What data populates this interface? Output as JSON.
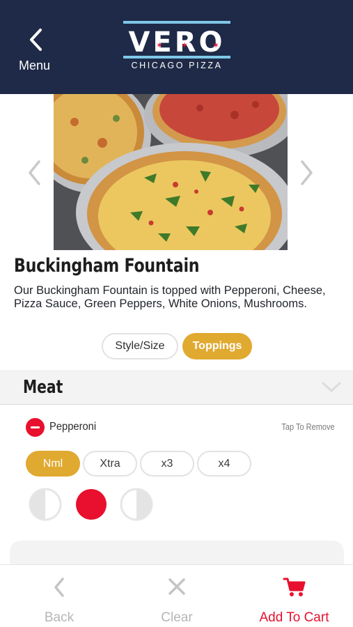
{
  "header": {
    "back_label": "Menu",
    "brand_name": "VERO",
    "brand_subtitle": "CHICAGO PIZZA"
  },
  "product": {
    "title": "Buckingham Fountain",
    "description": "Our Buckingham Fountain is topped with Pepperoni, Cheese, Pizza Sauce, Green Peppers, White Onions, Mushrooms."
  },
  "tabs": [
    {
      "label": "Style/Size",
      "active": false
    },
    {
      "label": "Toppings",
      "active": true
    }
  ],
  "section": {
    "title": "Meat"
  },
  "topping": {
    "name": "Pepperoni",
    "hint": "Tap To Remove",
    "amounts": [
      {
        "label": "Nml",
        "selected": true
      },
      {
        "label": "Xtra",
        "selected": false
      },
      {
        "label": "x3",
        "selected": false
      },
      {
        "label": "x4",
        "selected": false
      }
    ],
    "coverage": [
      {
        "name": "left-half",
        "selected": false
      },
      {
        "name": "whole",
        "selected": true
      },
      {
        "name": "right-half",
        "selected": false
      }
    ]
  },
  "bottom_bar": {
    "back_label": "Back",
    "clear_label": "Clear",
    "cart_label": "Add To Cart"
  },
  "colors": {
    "header_bg": "#1e2a47",
    "accent_gold": "#e0a930",
    "accent_red": "#e8102e",
    "logo_blue": "#7fc8e8"
  },
  "icons": [
    "chevron-left-icon",
    "chevron-right-icon",
    "chevron-down-icon",
    "minus-circle-icon",
    "close-icon",
    "cart-icon"
  ]
}
